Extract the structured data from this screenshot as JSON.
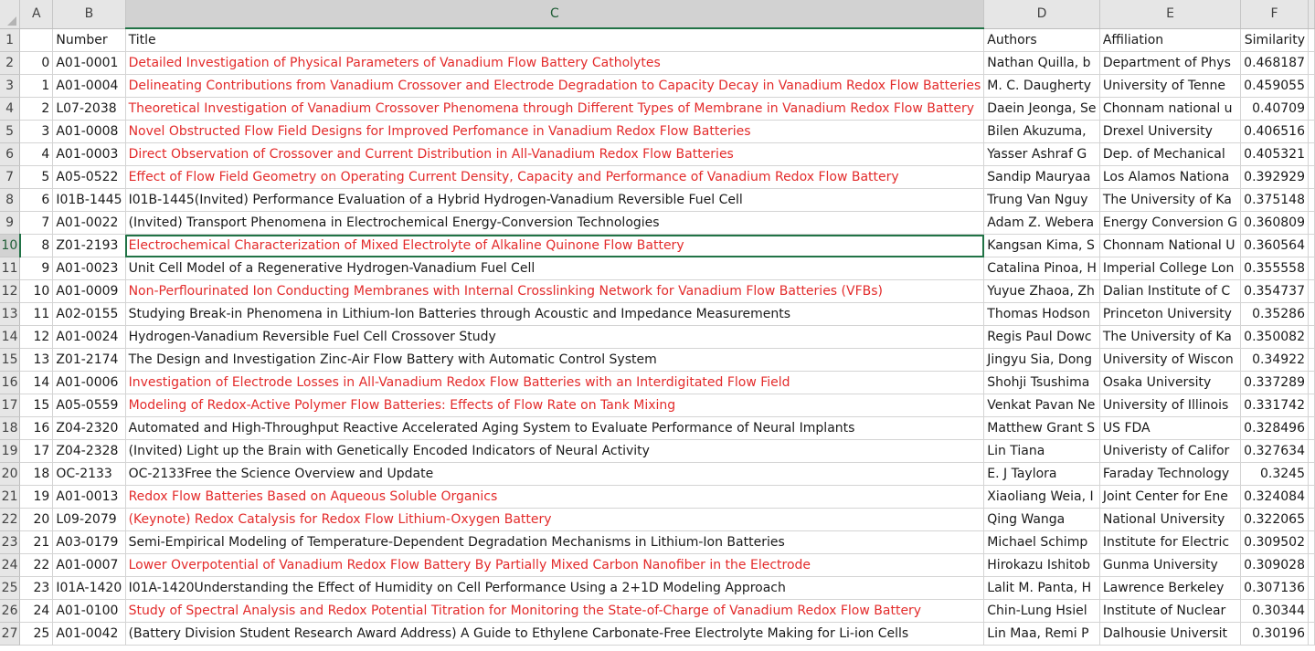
{
  "column_headers": [
    "A",
    "B",
    "C",
    "D",
    "E",
    "F"
  ],
  "active_column": "C",
  "active_row": "10",
  "colors": {
    "red_text": "#e32b2b",
    "selection": "#217346"
  },
  "rows": [
    {
      "n": "1",
      "a": "",
      "b": "Number",
      "c": "Title",
      "d": "Authors",
      "e": "Affiliation",
      "f": "Similarity",
      "red": false
    },
    {
      "n": "2",
      "a": "0",
      "b": "A01-0001",
      "c": "Detailed Investigation of Physical Parameters of Vanadium Flow Battery Catholytes",
      "d": "Nathan Quilla, b",
      "e": "Department of Phys",
      "f": "0.468187",
      "red": true
    },
    {
      "n": "3",
      "a": "1",
      "b": "A01-0004",
      "c": "Delineating Contributions from Vanadium Crossover and Electrode Degradation to Capacity Decay in Vanadium Redox Flow Batteries",
      "d": "M. C. Daugherty",
      "e": "University of Tenne",
      "f": "0.459055",
      "red": true
    },
    {
      "n": "4",
      "a": "2",
      "b": "L07-2038",
      "c": "Theoretical Investigation of Vanadium Crossover Phenomena through Different Types of Membrane in Vanadium Redox Flow Battery",
      "d": "Daein Jeonga, Se",
      "e": "Chonnam national u",
      "f": "0.40709",
      "red": true
    },
    {
      "n": "5",
      "a": "3",
      "b": "A01-0008",
      "c": "Novel Obstructed Flow Field Designs for Improved Perfomance in Vanadium Redox Flow Batteries",
      "d": "Bilen Akuzuma,",
      "e": "Drexel University",
      "f": "0.406516",
      "red": true
    },
    {
      "n": "6",
      "a": "4",
      "b": "A01-0003",
      "c": "Direct Observation of Crossover and Current Distribution in All-Vanadium Redox Flow Batteries",
      "d": "Yasser Ashraf G",
      "e": "Dep. of Mechanical",
      "f": "0.405321",
      "red": true
    },
    {
      "n": "7",
      "a": "5",
      "b": "A05-0522",
      "c": "Effect of Flow Field Geometry on Operating Current Density, Capacity and Performance of Vanadium Redox Flow Battery",
      "d": "Sandip Mauryaa",
      "e": "Los Alamos Nationa",
      "f": "0.392929",
      "red": true
    },
    {
      "n": "8",
      "a": "6",
      "b": "I01B-1445",
      "c": "I01B-1445(Invited) Performance Evaluation of a Hybrid Hydrogen-Vanadium Reversible Fuel Cell",
      "d": "Trung Van Nguy",
      "e": "The University of Ka",
      "f": "0.375148",
      "red": false
    },
    {
      "n": "9",
      "a": "7",
      "b": "A01-0022",
      "c": "(Invited) Transport Phenomena in Electrochemical Energy-Conversion Technologies",
      "d": "Adam Z. Webera",
      "e": "Energy Conversion G",
      "f": "0.360809",
      "red": false
    },
    {
      "n": "10",
      "a": "8",
      "b": "Z01-2193",
      "c": "Electrochemical Characterization of Mixed Electrolyte of Alkaline Quinone Flow Battery",
      "d": "Kangsan Kima, S",
      "e": "Chonnam National U",
      "f": "0.360564",
      "red": true,
      "sel": true
    },
    {
      "n": "11",
      "a": "9",
      "b": "A01-0023",
      "c": "Unit Cell Model of a Regenerative Hydrogen-Vanadium Fuel Cell",
      "d": "Catalina Pinoa, H",
      "e": "Imperial College Lon",
      "f": "0.355558",
      "red": false
    },
    {
      "n": "12",
      "a": "10",
      "b": "A01-0009",
      "c": "Non-Perflourinated Ion Conducting Membranes with Internal Crosslinking Network for Vanadium Flow Batteries (VFBs)",
      "d": "Yuyue Zhaoa, Zh",
      "e": "Dalian Institute of C",
      "f": "0.354737",
      "red": true
    },
    {
      "n": "13",
      "a": "11",
      "b": "A02-0155",
      "c": "Studying Break-in Phenomena in Lithium-Ion Batteries through Acoustic and Impedance Measurements",
      "d": "Thomas Hodson",
      "e": "Princeton University",
      "f": "0.35286",
      "red": false
    },
    {
      "n": "14",
      "a": "12",
      "b": "A01-0024",
      "c": "Hydrogen-Vanadium Reversible Fuel Cell Crossover Study",
      "d": "Regis Paul Dowc",
      "e": "The University of Ka",
      "f": "0.350082",
      "red": false
    },
    {
      "n": "15",
      "a": "13",
      "b": "Z01-2174",
      "c": "The Design and Investigation Zinc-Air Flow Battery with Automatic Control System",
      "d": "Jingyu Sia, Dong",
      "e": "University of Wiscon",
      "f": "0.34922",
      "red": false
    },
    {
      "n": "16",
      "a": "14",
      "b": "A01-0006",
      "c": "Investigation of Electrode Losses in All-Vanadium Redox Flow Batteries with an Interdigitated Flow Field",
      "d": "Shohji Tsushima",
      "e": "Osaka University",
      "f": "0.337289",
      "red": true
    },
    {
      "n": "17",
      "a": "15",
      "b": "A05-0559",
      "c": "Modeling of Redox-Active Polymer Flow Batteries: Effects of Flow Rate on Tank Mixing",
      "d": "Venkat Pavan Ne",
      "e": "University of Illinois",
      "f": "0.331742",
      "red": true
    },
    {
      "n": "18",
      "a": "16",
      "b": "Z04-2320",
      "c": "Automated and High-Throughput Reactive Accelerated Aging System to Evaluate Performance of Neural Implants",
      "d": "Matthew Grant S",
      "e": "US FDA",
      "f": "0.328496",
      "red": false
    },
    {
      "n": "19",
      "a": "17",
      "b": "Z04-2328",
      "c": "(Invited) Light up the Brain with Genetically Encoded Indicators of Neural Activity",
      "d": "Lin Tiana",
      "e": "Univeristy of Califor",
      "f": "0.327634",
      "red": false
    },
    {
      "n": "20",
      "a": "18",
      "b": "OC-2133",
      "c": "OC-2133Free the Science Overview and Update",
      "d": "E. J Taylora",
      "e": "Faraday Technology",
      "f": "0.3245",
      "red": false
    },
    {
      "n": "21",
      "a": "19",
      "b": "A01-0013",
      "c": "Redox Flow Batteries Based on Aqueous Soluble Organics",
      "d": "Xiaoliang Weia, I",
      "e": "Joint Center for Ene",
      "f": "0.324084",
      "red": true
    },
    {
      "n": "22",
      "a": "20",
      "b": "L09-2079",
      "c": "(Keynote) Redox Catalysis for Redox Flow Lithium-Oxygen Battery",
      "d": "Qing Wanga",
      "e": "National University",
      "f": "0.322065",
      "red": true
    },
    {
      "n": "23",
      "a": "21",
      "b": "A03-0179",
      "c": "Semi-Empirical Modeling of Temperature-Dependent Degradation Mechanisms in Lithium-Ion Batteries",
      "d": "Michael Schimp",
      "e": "Institute for Electric",
      "f": "0.309502",
      "red": false
    },
    {
      "n": "24",
      "a": "22",
      "b": "A01-0007",
      "c": "Lower Overpotential of Vanadium Redox Flow Battery By Partially Mixed Carbon Nanofiber in the Electrode",
      "d": "Hirokazu Ishitob",
      "e": "Gunma University",
      "f": "0.309028",
      "red": true
    },
    {
      "n": "25",
      "a": "23",
      "b": "I01A-1420",
      "c": "I01A-1420Understanding the Effect of Humidity on Cell Performance Using a 2+1D Modeling Approach",
      "d": "Lalit M. Panta, H",
      "e": "Lawrence Berkeley",
      "f": "0.307136",
      "red": false
    },
    {
      "n": "26",
      "a": "24",
      "b": "A01-0100",
      "c": "Study of Spectral Analysis and Redox Potential Titration for Monitoring the State-of-Charge of Vanadium Redox Flow Battery",
      "d": "Chin-Lung Hsiel",
      "e": "Institute of Nuclear",
      "f": "0.30344",
      "red": true
    },
    {
      "n": "27",
      "a": "25",
      "b": "A01-0042",
      "c": "(Battery Division Student Research Award Address)  A Guide to Ethylene Carbonate-Free Electrolyte Making for Li-ion Cells",
      "d": "Lin Maa, Remi P",
      "e": "Dalhousie Universit",
      "f": "0.30196",
      "red": false
    }
  ]
}
